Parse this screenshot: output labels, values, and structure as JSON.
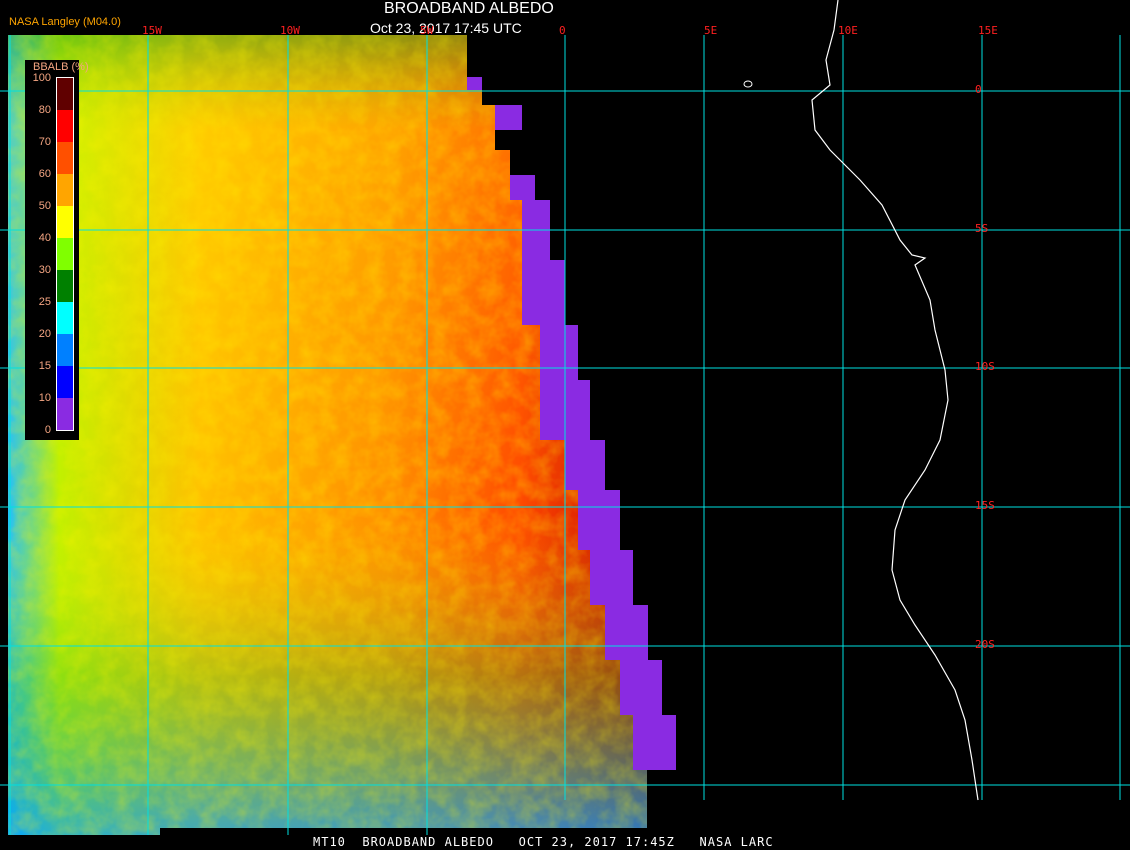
{
  "header": {
    "title": "BROADBAND ALBEDO",
    "subtitle": "Oct 23, 2017 17:45 UTC",
    "credit": "NASA Langley (M04.0)"
  },
  "footer": "MT10  BROADBAND ALBEDO   OCT 23, 2017 17:45Z   NASA LARC",
  "longitude_labels": [
    "15W",
    "10W",
    "5W",
    "0",
    "5E",
    "10E",
    "15E"
  ],
  "latitude_labels": [
    "0",
    "5S",
    "10S",
    "15S",
    "20S"
  ],
  "legend": {
    "title": "BBALB (%)",
    "ticks": [
      "0",
      "10",
      "15",
      "20",
      "25",
      "30",
      "40",
      "50",
      "60",
      "70",
      "80",
      "100"
    ],
    "colors": [
      "#8a2be2",
      "#0000ff",
      "#0080ff",
      "#00ffff",
      "#008000",
      "#80ff00",
      "#ffff00",
      "#ffa500",
      "#ff5000",
      "#ff0000",
      "#600000"
    ]
  },
  "colors": {
    "grid": "#00e0e0",
    "labels": "#ff2020",
    "coast": "#ffffff",
    "missing": "#8a2be2"
  }
}
